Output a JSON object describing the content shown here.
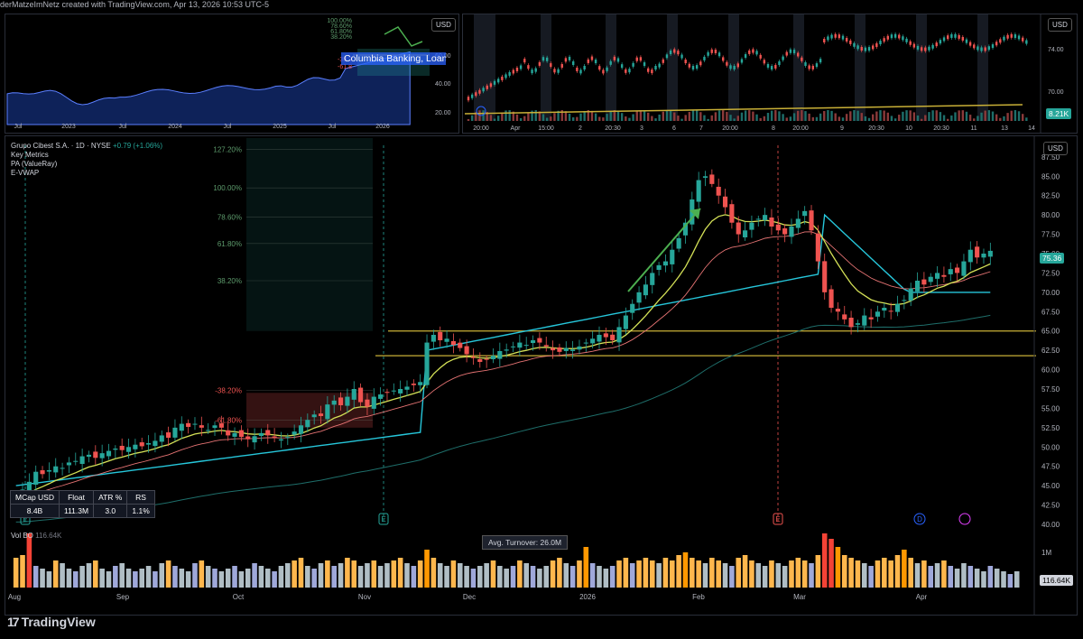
{
  "header": {
    "attribution": "derMatzeImNetz created with TradingView.com, Apr 13, 2026 10:53 UTC-5"
  },
  "brand": {
    "name": "TradingView"
  },
  "panel_top_left": {
    "currency": "USD",
    "x_labels": [
      "Jul",
      "2023",
      "Jul",
      "2024",
      "Jul",
      "2025",
      "Jul",
      "2026"
    ],
    "y_labels": [
      "60.00",
      "40.00",
      "20.00"
    ],
    "fib_labels": [
      "100.00%",
      "78.60%",
      "61.80%",
      "38.20%",
      "-38.2",
      "-61.8"
    ],
    "company_label": "Columbia Banking, Loans, Inv"
  },
  "panel_top_right": {
    "currency": "USD",
    "x_labels": [
      "20:00",
      "Apr",
      "15:00",
      "2",
      "20:30",
      "3",
      "6",
      "7",
      "20:00",
      "8",
      "20:00",
      "9",
      "20:30",
      "10",
      "20:30",
      "11",
      "13",
      "14"
    ],
    "y_labels": [
      "74.00",
      "70.00",
      "65.00"
    ],
    "volume_tag": "8.21K"
  },
  "main_chart": {
    "legend": {
      "symbol": "Grupo Cibest S.A. · 1D · NYSE",
      "change": "+0.79 (+1.06%)",
      "indicators": [
        "Key Metrics",
        "PA (ValueRay)",
        "E-VWAP"
      ]
    },
    "currency": "USD",
    "last_price": "75.36",
    "volume_label": "Vol BO",
    "volume_value": "116.64K",
    "volume_tag": "116.64K",
    "volume_axis": "1M",
    "avg_turnover": "Avg. Turnover: 26.0M",
    "fib_labels": [
      "127.20%",
      "100.00%",
      "78.60%",
      "61.80%",
      "38.20%",
      "-38.20%",
      "-61.80%"
    ],
    "key_metrics": {
      "headers": [
        "MCap USD",
        "Float",
        "ATR %",
        "RS"
      ],
      "values": [
        "8.4B",
        "111.3M",
        "3.0",
        "1.1%"
      ]
    },
    "event_markers": [
      "E",
      "E",
      "E",
      "D"
    ]
  },
  "chart_data": {
    "type": "candlestick",
    "x_labels": [
      "Aug",
      "Sep",
      "Oct",
      "Nov",
      "Dec",
      "2026",
      "Feb",
      "Mar",
      "Apr"
    ],
    "y_ticks": [
      "87.50",
      "85.00",
      "82.50",
      "80.00",
      "77.50",
      "75.00",
      "72.50",
      "70.00",
      "67.50",
      "65.00",
      "62.50",
      "60.00",
      "57.50",
      "55.00",
      "52.50",
      "50.00",
      "47.50",
      "45.00",
      "42.50",
      "40.00"
    ],
    "ylim": [
      40,
      89
    ],
    "closes": [
      43.5,
      44.5,
      45.5,
      46.8,
      46.5,
      47,
      47.5,
      47.3,
      48,
      48.2,
      48.8,
      49,
      48.6,
      49.2,
      49.5,
      49.8,
      49.6,
      50,
      50.3,
      50.1,
      50.5,
      50.8,
      51.5,
      51.2,
      52.5,
      53,
      52.6,
      53,
      52.5,
      52.2,
      52.8,
      52.5,
      51.5,
      51.8,
      51.3,
      51,
      51.4,
      51.8,
      51.5,
      51.2,
      51,
      51.3,
      52,
      52.8,
      53.5,
      54.2,
      54,
      55.5,
      56,
      55.4,
      56.5,
      57.5,
      55.8,
      55.2,
      56.5,
      56.8,
      57,
      57.3,
      57.5,
      57.8,
      58,
      58.4,
      63.5,
      64.5,
      63.8,
      64,
      63.2,
      62.8,
      62,
      61.5,
      61,
      61.3,
      61.8,
      62.4,
      62.6,
      63,
      63.5,
      63.2,
      63.8,
      63.5,
      63,
      62.5,
      62.3,
      62.8,
      62.6,
      63,
      63.5,
      64,
      64.5,
      64.2,
      63.8,
      65.5,
      67,
      68.5,
      70,
      71,
      72.5,
      73.5,
      74,
      75.5,
      77,
      79,
      82,
      84.5,
      85,
      84,
      82.5,
      81,
      79,
      77.5,
      78,
      79,
      79.5,
      80,
      78.5,
      78,
      77.5,
      78.5,
      79.5,
      80.5,
      78,
      74,
      70,
      68,
      67.5,
      66.5,
      65.5,
      66,
      67,
      66.5,
      67.5,
      68,
      67.5,
      68.5,
      69,
      70.5,
      71.5,
      71,
      72,
      72.5,
      72,
      73,
      72.5,
      74,
      75.5,
      74.5,
      75,
      75.36
    ],
    "series": [
      {
        "name": "E-VWAP"
      },
      {
        "name": "PA (ValueRay)"
      }
    ],
    "levels": [
      65,
      61.8
    ],
    "volume": [
      0.55,
      0.6,
      1.0,
      0.4,
      0.35,
      0.3,
      0.5,
      0.45,
      0.35,
      0.3,
      0.4,
      0.45,
      0.5,
      0.35,
      0.3,
      0.4,
      0.45,
      0.35,
      0.3,
      0.35,
      0.4,
      0.3,
      0.45,
      0.5,
      0.4,
      0.35,
      0.3,
      0.45,
      0.5,
      0.4,
      0.35,
      0.3,
      0.35,
      0.4,
      0.3,
      0.35,
      0.45,
      0.4,
      0.35,
      0.3,
      0.4,
      0.45,
      0.5,
      0.55,
      0.4,
      0.35,
      0.45,
      0.5,
      0.4,
      0.45,
      0.55,
      0.5,
      0.4,
      0.45,
      0.5,
      0.4,
      0.45,
      0.5,
      0.55,
      0.45,
      0.4,
      0.5,
      0.7,
      0.55,
      0.45,
      0.4,
      0.5,
      0.45,
      0.4,
      0.35,
      0.4,
      0.45,
      0.5,
      0.4,
      0.35,
      0.4,
      0.5,
      0.45,
      0.4,
      0.35,
      0.4,
      0.5,
      0.55,
      0.45,
      0.4,
      0.5,
      0.75,
      0.45,
      0.4,
      0.35,
      0.4,
      0.5,
      0.55,
      0.45,
      0.5,
      0.55,
      0.5,
      0.45,
      0.55,
      0.5,
      0.6,
      0.65,
      0.55,
      0.5,
      0.45,
      0.55,
      0.5,
      0.45,
      0.4,
      0.55,
      0.6,
      0.5,
      0.45,
      0.4,
      0.5,
      0.45,
      0.4,
      0.5,
      0.55,
      0.5,
      0.45,
      0.6,
      1.0,
      0.9,
      0.75,
      0.6,
      0.55,
      0.5,
      0.45,
      0.4,
      0.5,
      0.55,
      0.5,
      0.6,
      0.7,
      0.55,
      0.45,
      0.5,
      0.4,
      0.45,
      0.5,
      0.4,
      0.35,
      0.45,
      0.4,
      0.35,
      0.3,
      0.4,
      0.35,
      0.3,
      0.25,
      0.3
    ]
  },
  "colors": {
    "up": "#26a69a",
    "down": "#ef5350",
    "vwap": "#26c6da",
    "level": "#c9b037",
    "background": "#000000"
  }
}
